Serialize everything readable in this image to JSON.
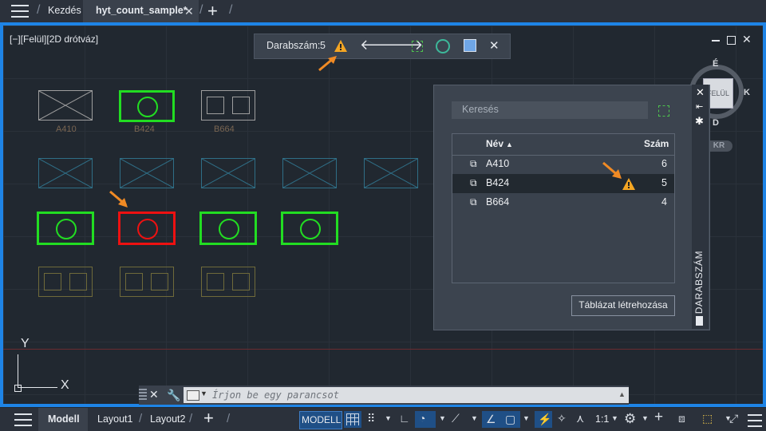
{
  "tabs": {
    "home": "Kezdés",
    "active": "hyt_count_sample*",
    "close": "✕",
    "new": "+"
  },
  "viewport": {
    "label": "[−][Felül][2D drótváz]"
  },
  "count_toolbar": {
    "label": "Darabszám:",
    "value": "5"
  },
  "viewcube": {
    "top": "É",
    "right": "K",
    "bottom": "D",
    "face": "FELÜL",
    "wcs": "KR"
  },
  "blocks": {
    "label_a410": "A410",
    "label_b424": "B424",
    "label_b664": "B664"
  },
  "panel": {
    "search_placeholder": "Keresés",
    "col_name": "Név",
    "col_count": "Szám",
    "rows": [
      {
        "name": "A410",
        "count": "6"
      },
      {
        "name": "B424",
        "count": "5"
      },
      {
        "name": "B664",
        "count": "4"
      }
    ],
    "create_table": "Táblázat létrehozása",
    "side_title": "DARABSZÁM"
  },
  "command": {
    "placeholder": "Írjon be egy parancsot"
  },
  "statusbar": {
    "model_tab": "Modell",
    "layout1": "Layout1",
    "layout2": "Layout2",
    "model_btn": "MODELL",
    "scale": "1:1"
  },
  "colors": {
    "accent": "#1e84e6",
    "green": "#22dd22",
    "red": "#ee1111",
    "warning": "#f5a623",
    "arrow": "#f08a24"
  }
}
